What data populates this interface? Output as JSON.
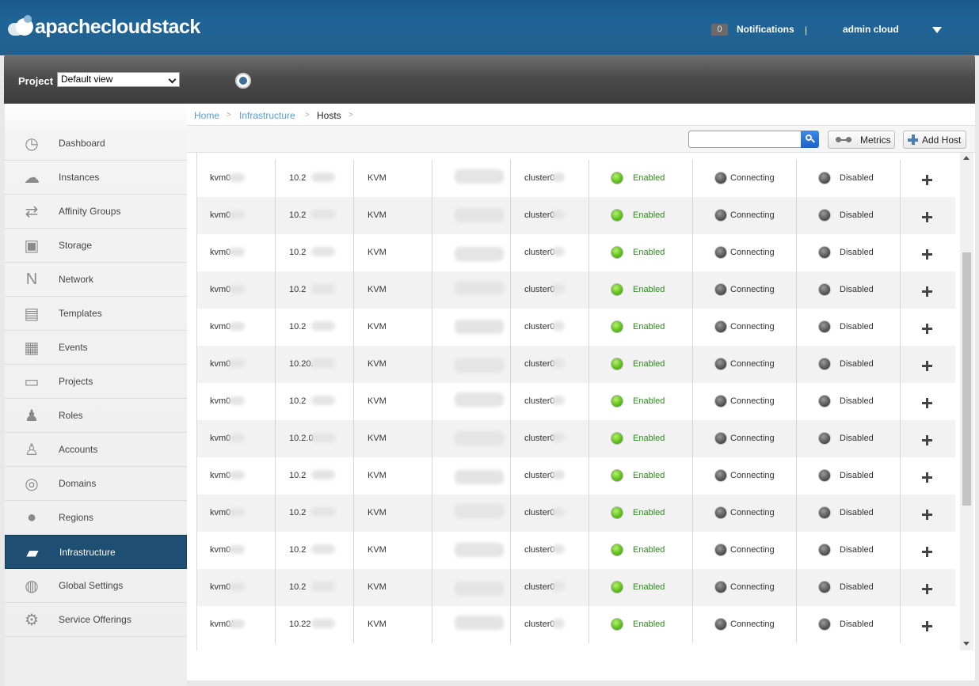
{
  "header": {
    "logo_text": "apachecloudstack",
    "notifications_count": "0",
    "notifications_label": "Notifications",
    "separator": "|",
    "user_name": "admin cloud"
  },
  "project_bar": {
    "label": "Project",
    "selected": "Default view"
  },
  "sidebar": {
    "items": [
      {
        "label": "Dashboard",
        "icon": "dashboard-icon"
      },
      {
        "label": "Instances",
        "icon": "cloud-icon"
      },
      {
        "label": "Affinity Groups",
        "icon": "affinity-icon"
      },
      {
        "label": "Storage",
        "icon": "storage-icon"
      },
      {
        "label": "Network",
        "icon": "network-icon"
      },
      {
        "label": "Templates",
        "icon": "templates-icon"
      },
      {
        "label": "Events",
        "icon": "calendar-icon"
      },
      {
        "label": "Projects",
        "icon": "folder-icon"
      },
      {
        "label": "Roles",
        "icon": "roles-icon"
      },
      {
        "label": "Accounts",
        "icon": "user-icon"
      },
      {
        "label": "Domains",
        "icon": "domains-icon"
      },
      {
        "label": "Regions",
        "icon": "globe-icon"
      },
      {
        "label": "Infrastructure",
        "icon": "infrastructure-icon",
        "active": true
      },
      {
        "label": "Global Settings",
        "icon": "globe-settings-icon"
      },
      {
        "label": "Service Offerings",
        "icon": "gear-icon"
      }
    ]
  },
  "breadcrumb": {
    "home": "Home",
    "infrastructure": "Infrastructure",
    "hosts": "Hosts",
    "sep": ">"
  },
  "toolbar": {
    "metrics_label": "Metrics",
    "add_host_label": "Add Host"
  },
  "hosts": [
    {
      "name": "kvm0",
      "ip": "10.2",
      "hypervisor": "KVM",
      "cluster": "cluster0",
      "state": "Enabled",
      "agent": "Connecting",
      "ha": "Disabled"
    },
    {
      "name": "kvm0",
      "ip": "10.2",
      "hypervisor": "KVM",
      "cluster": "cluster0",
      "state": "Enabled",
      "agent": "Connecting",
      "ha": "Disabled"
    },
    {
      "name": "kvm0",
      "ip": "10.2",
      "hypervisor": "KVM",
      "cluster": "cluster0",
      "state": "Enabled",
      "agent": "Connecting",
      "ha": "Disabled"
    },
    {
      "name": "kvm0",
      "ip": "10.2",
      "hypervisor": "KVM",
      "cluster": "cluster0",
      "state": "Enabled",
      "agent": "Connecting",
      "ha": "Disabled"
    },
    {
      "name": "kvm0",
      "ip": "10.2",
      "hypervisor": "KVM",
      "cluster": "cluster0",
      "state": "Enabled",
      "agent": "Connecting",
      "ha": "Disabled"
    },
    {
      "name": "kvm0",
      "ip": "10.20.",
      "hypervisor": "KVM",
      "cluster": "cluster0",
      "state": "Enabled",
      "agent": "Connecting",
      "ha": "Disabled"
    },
    {
      "name": "kvm0",
      "ip": "10.2",
      "hypervisor": "KVM",
      "cluster": "cluster0",
      "state": "Enabled",
      "agent": "Connecting",
      "ha": "Disabled"
    },
    {
      "name": "kvm0",
      "ip": "10.2.0.",
      "hypervisor": "KVM",
      "cluster": "cluster0",
      "state": "Enabled",
      "agent": "Connecting",
      "ha": "Disabled"
    },
    {
      "name": "kvm0",
      "ip": "10.2",
      "hypervisor": "KVM",
      "cluster": "cluster0",
      "state": "Enabled",
      "agent": "Connecting",
      "ha": "Disabled"
    },
    {
      "name": "kvm0",
      "ip": "10.2",
      "hypervisor": "KVM",
      "cluster": "cluster0",
      "state": "Enabled",
      "agent": "Connecting",
      "ha": "Disabled"
    },
    {
      "name": "kvm0",
      "ip": "10.2",
      "hypervisor": "KVM",
      "cluster": "cluster0",
      "state": "Enabled",
      "agent": "Connecting",
      "ha": "Disabled"
    },
    {
      "name": "kvm0",
      "ip": "10.2",
      "hypervisor": "KVM",
      "cluster": "cluster0",
      "state": "Enabled",
      "agent": "Connecting",
      "ha": "Disabled"
    },
    {
      "name": "kvm0/n",
      "ip": "10.22",
      "hypervisor": "KVM",
      "cluster": "cluster0",
      "state": "Enabled",
      "agent": "Connecting",
      "ha": "Disabled"
    }
  ],
  "colors": {
    "header_bg": "#1f6496",
    "active_nav": "#1e4f72",
    "link": "#5a9bd0",
    "enabled_text": "#2c8a1b"
  }
}
